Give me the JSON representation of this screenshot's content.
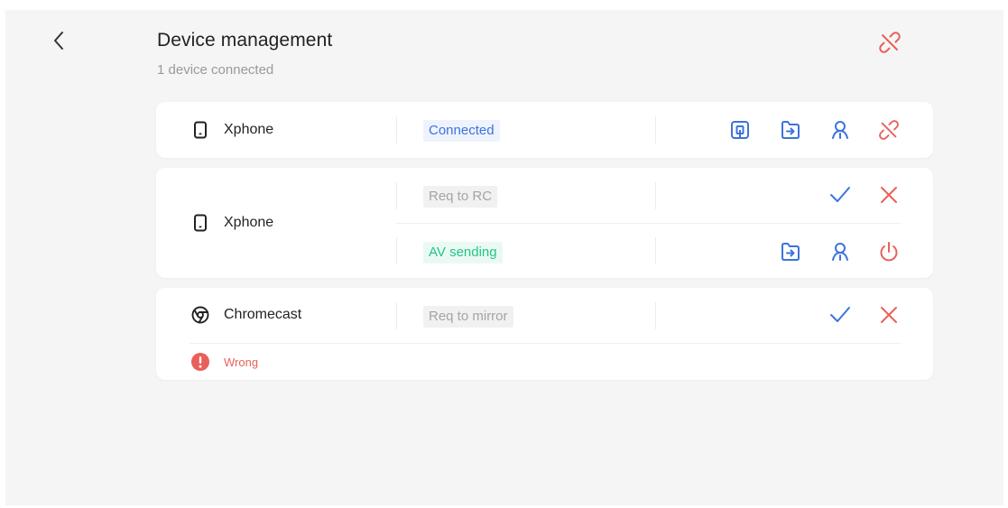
{
  "header": {
    "title": "Device management",
    "subtitle": "1 device connected",
    "back_icon": "chevron-left-icon",
    "disconnect_icon": "unlink-icon"
  },
  "colors": {
    "blue": "#3d73dc",
    "red": "#e9605a",
    "green": "#23c587",
    "grey": "#a4a4a4"
  },
  "devices": [
    {
      "name": "Xphone",
      "icon": "phone-icon",
      "status": "Connected",
      "actions": [
        "screen-share-icon",
        "file-transfer-icon",
        "user-icon",
        "unlink-icon"
      ]
    },
    {
      "name": "Xphone",
      "icon": "phone-icon",
      "rows": [
        {
          "status": "Req to RC",
          "actions": [
            "check-icon",
            "close-icon"
          ]
        },
        {
          "status": "AV sending",
          "actions": [
            "file-transfer-icon",
            "user-icon",
            "power-icon"
          ]
        }
      ]
    },
    {
      "name": "Chromecast",
      "icon": "chromecast-icon",
      "status": "Req to mirror",
      "actions": [
        "check-icon",
        "close-icon"
      ],
      "error": {
        "icon": "alert-icon",
        "text": "Wrong"
      }
    }
  ]
}
